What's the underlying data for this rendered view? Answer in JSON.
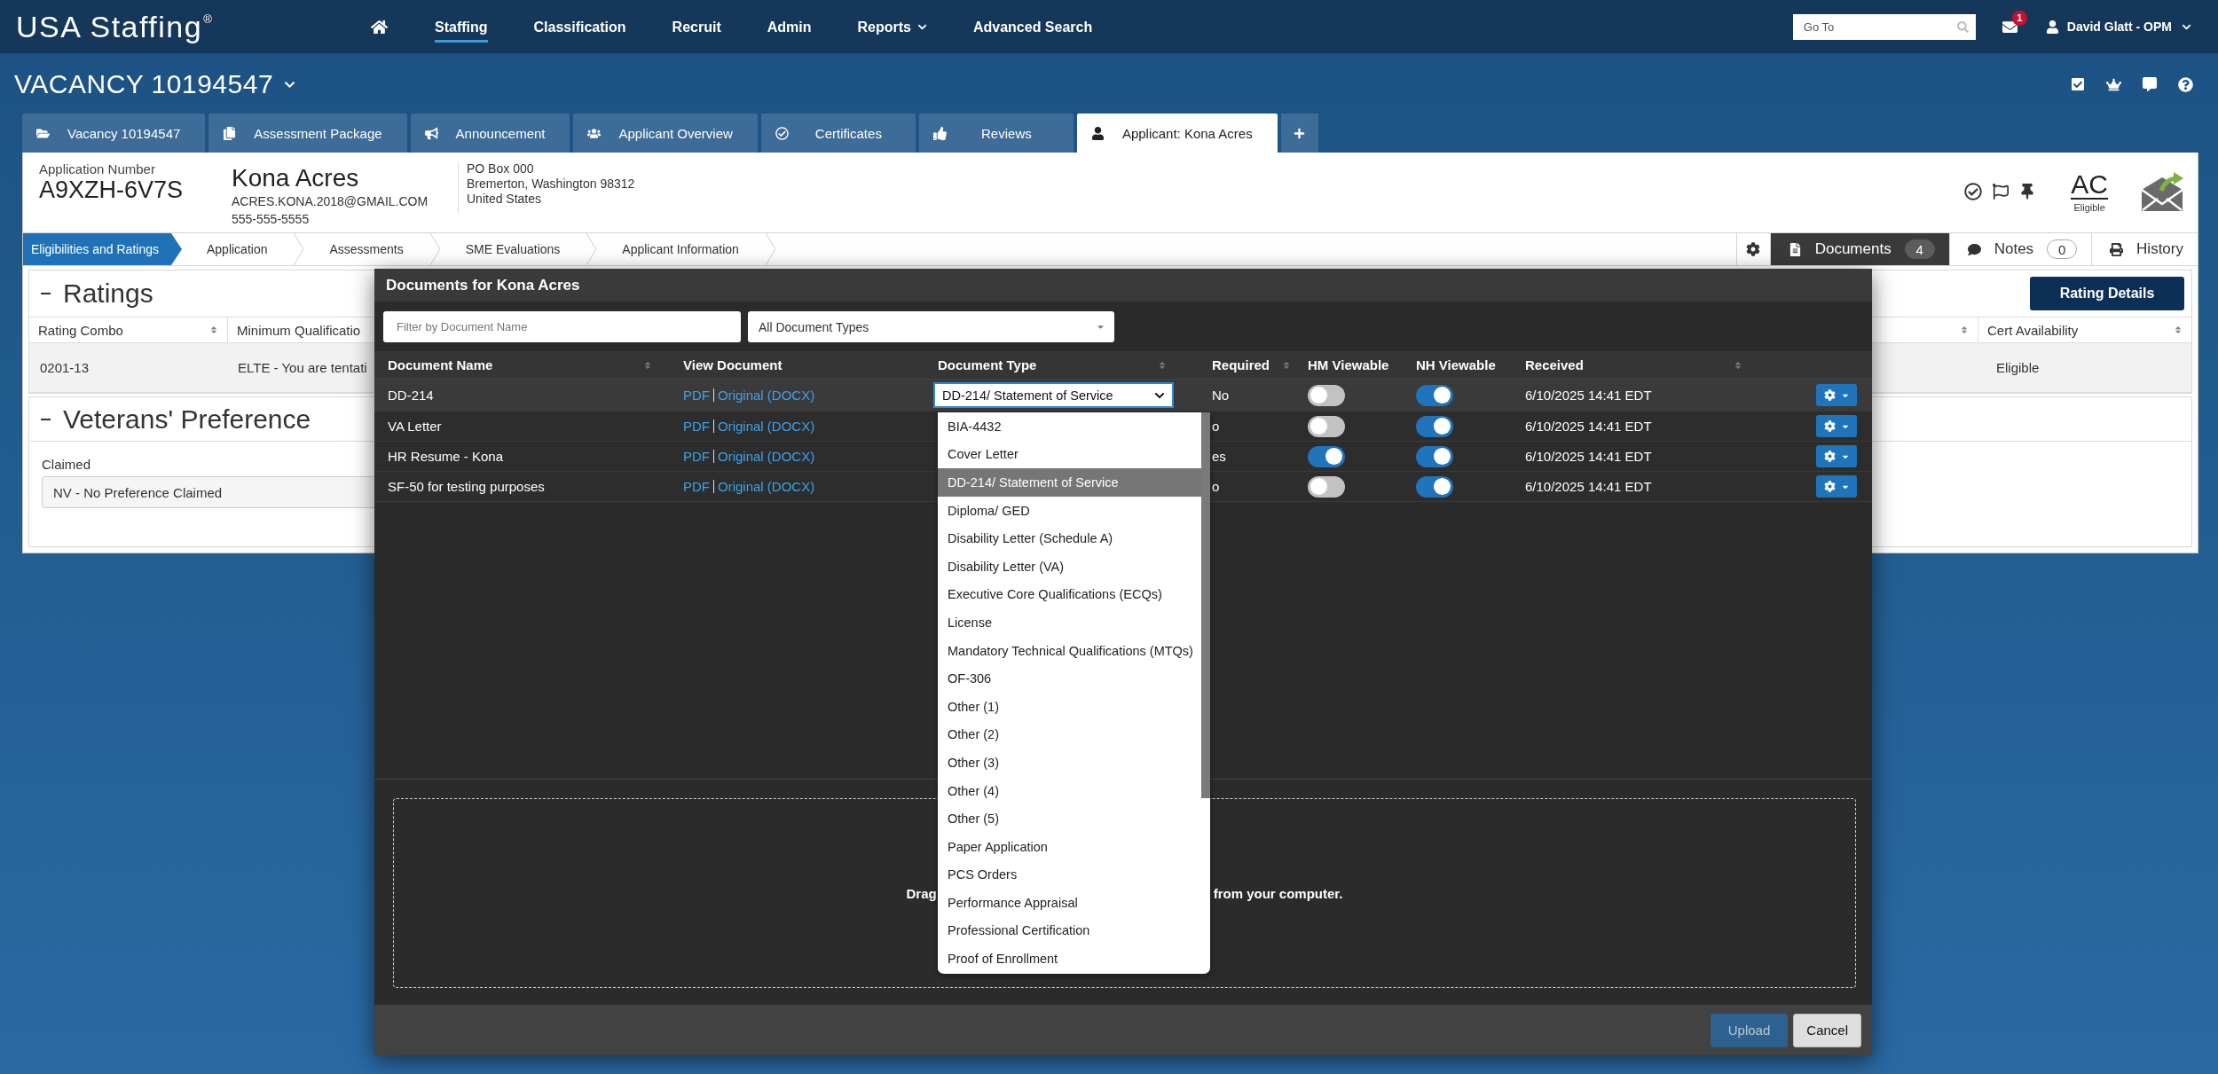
{
  "top_nav": {
    "logo": "USA Staffing$^{®}$",
    "items": [
      {
        "label": "Staffing",
        "selected": true,
        "dropdown": false
      },
      {
        "label": "Classification",
        "selected": false,
        "dropdown": false
      },
      {
        "label": "Recruit",
        "selected": false,
        "dropdown": false
      },
      {
        "label": "Admin",
        "selected": false,
        "dropdown": false
      },
      {
        "label": "Reports",
        "selected": false,
        "dropdown": true
      },
      {
        "label": "Advanced Search",
        "selected": false,
        "dropdown": false
      }
    ],
    "go_to": {
      "placeholder": "Go To"
    },
    "mail_badge": "1",
    "user": "David Glatt - OPM"
  },
  "vacancy": {
    "title": "VACANCY 10194547"
  },
  "tabs": [
    {
      "label": "Vacancy 10194547",
      "selected": false
    },
    {
      "label": "Assessment Package",
      "selected": false
    },
    {
      "label": "Announcement",
      "selected": false
    },
    {
      "label": "Applicant Overview",
      "selected": false
    },
    {
      "label": "Certificates",
      "selected": false
    },
    {
      "label": "Reviews",
      "selected": false
    },
    {
      "label": "Applicant: Kona Acres",
      "selected": true
    }
  ],
  "applicant": {
    "number_label": "Application Number",
    "number": "A9XZH-6V7S",
    "name": "Kona Acres",
    "email": "ACRES.KONA.2018@GMAIL.COM",
    "phone": "555-555-5555",
    "address": [
      "PO Box 000",
      "Bremerton, Washington 98312",
      "United States"
    ],
    "rating_code": "AC",
    "rating_status": "Eligible"
  },
  "steps": [
    {
      "label": "Eligibilities and Ratings",
      "selected": true
    },
    {
      "label": "Application",
      "selected": false
    },
    {
      "label": "Assessments",
      "selected": false
    },
    {
      "label": "SME Evaluations",
      "selected": false
    },
    {
      "label": "Applicant Information",
      "selected": false
    }
  ],
  "side_tabs": [
    {
      "label": "Documents",
      "count": "4",
      "selected": true
    },
    {
      "label": "Notes",
      "count": "0",
      "selected": false
    },
    {
      "label": "History",
      "selected": false
    }
  ],
  "ratings": {
    "title": "Ratings",
    "button": "Rating Details",
    "columns": [
      {
        "label": "Rating Combo",
        "sortable": true
      },
      {
        "label": "Minimum Qualificatio",
        "sortable": false
      },
      {
        "sortable": true
      },
      {
        "label": "Cert Availability",
        "sortable": true
      }
    ],
    "rows": [
      {
        "rating_combo": "0201-13",
        "minimum_qualification": "ELTE - You are tentati",
        "cert_availability": "Eligible"
      }
    ]
  },
  "veterans_preference": {
    "title": "Veterans' Preference",
    "field_label": "Claimed",
    "value": "NV - No Preference Claimed"
  },
  "documents_dialog": {
    "title": "Documents for Kona Acres",
    "name_filter": {
      "placeholder": "Filter by Document Name"
    },
    "type_filter": {
      "value": "All Document Types"
    },
    "columns": [
      {
        "label": "Document Name",
        "sortable": true
      },
      {
        "label": "View Document",
        "sortable": false
      },
      {
        "label": "Document Type",
        "sortable": true
      },
      {
        "label": "Required",
        "sortable": true
      },
      {
        "label": "HM Viewable",
        "sortable": false
      },
      {
        "label": "NH Viewable",
        "sortable": false
      },
      {
        "label": "Received",
        "sortable": true
      }
    ],
    "rows": [
      {
        "name": "DD-214",
        "links": [
          "PDF",
          "Original (DOCX)"
        ],
        "type": "DD-214/ Statement of Service",
        "required": "No",
        "hm_viewable": false,
        "nh_viewable": true,
        "received": "6/10/2025 14:41 EDT",
        "selected": true
      },
      {
        "name": "VA Letter",
        "links": [
          "PDF",
          "Original (DOCX)"
        ],
        "required": "o",
        "hm_viewable": false,
        "nh_viewable": true,
        "received": "6/10/2025 14:41 EDT",
        "selected": false
      },
      {
        "name": "HR Resume - Kona",
        "links": [
          "PDF",
          "Original (DOCX)"
        ],
        "required": "es",
        "hm_viewable": true,
        "nh_viewable": true,
        "received": "6/10/2025 14:41 EDT",
        "selected": false
      },
      {
        "name": "SF-50 for testing purposes",
        "links": [
          "PDF",
          "Original (DOCX)"
        ],
        "required": "o",
        "hm_viewable": false,
        "nh_viewable": true,
        "received": "6/10/2025 14:41 EDT",
        "selected": false
      }
    ],
    "type_menu": [
      {
        "label": "BIA-4432",
        "selected": false
      },
      {
        "label": "Cover Letter",
        "selected": false
      },
      {
        "label": "DD-214/ Statement of Service",
        "selected": true
      },
      {
        "label": "Diploma/ GED",
        "selected": false
      },
      {
        "label": "Disability Letter (Schedule A)",
        "selected": false
      },
      {
        "label": "Disability Letter (VA)",
        "selected": false
      },
      {
        "label": "Executive Core Qualifications (ECQs)",
        "selected": false
      },
      {
        "label": "License",
        "selected": false
      },
      {
        "label": "Mandatory Technical Qualifications (MTQs)",
        "selected": false
      },
      {
        "label": "OF-306",
        "selected": false
      },
      {
        "label": "Other (1)",
        "selected": false
      },
      {
        "label": "Other (2)",
        "selected": false
      },
      {
        "label": "Other (3)",
        "selected": false
      },
      {
        "label": "Other (4)",
        "selected": false
      },
      {
        "label": "Other (5)",
        "selected": false
      },
      {
        "label": "Paper Application",
        "selected": false
      },
      {
        "label": "PCS Orders",
        "selected": false
      },
      {
        "label": "Performance Appraisal",
        "selected": false
      },
      {
        "label": "Professional Certification",
        "selected": false
      },
      {
        "label": "Proof of Enrollment",
        "selected": false
      }
    ],
    "drop_zone": [
      "Drag",
      "from your computer."
    ],
    "buttons": [
      {
        "label": "Upload",
        "kind": "primary",
        "disabled": true
      },
      {
        "label": "Cancel",
        "kind": "secondary",
        "disabled": false
      }
    ]
  }
}
